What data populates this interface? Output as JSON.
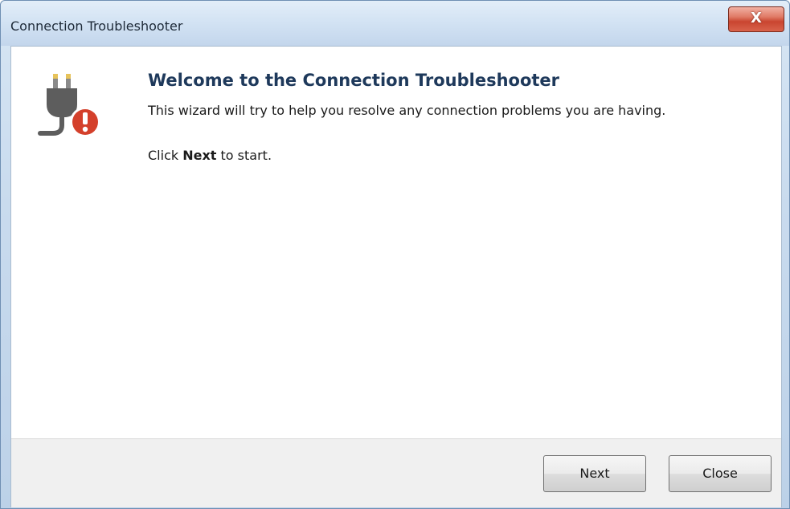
{
  "window": {
    "title": "Connection Troubleshooter",
    "close_glyph": "X"
  },
  "main": {
    "icon": "plug-warning-icon",
    "heading": "Welcome to the Connection Troubleshooter",
    "description": "This wizard will try to help you resolve any connection problems you are having.",
    "instruction_prefix": "Click ",
    "instruction_bold": "Next",
    "instruction_suffix": " to start."
  },
  "footer": {
    "next_label": "Next",
    "close_label": "Close"
  },
  "colors": {
    "heading": "#1e395b",
    "warning": "#d4402b",
    "plug": "#5d5d5d"
  }
}
